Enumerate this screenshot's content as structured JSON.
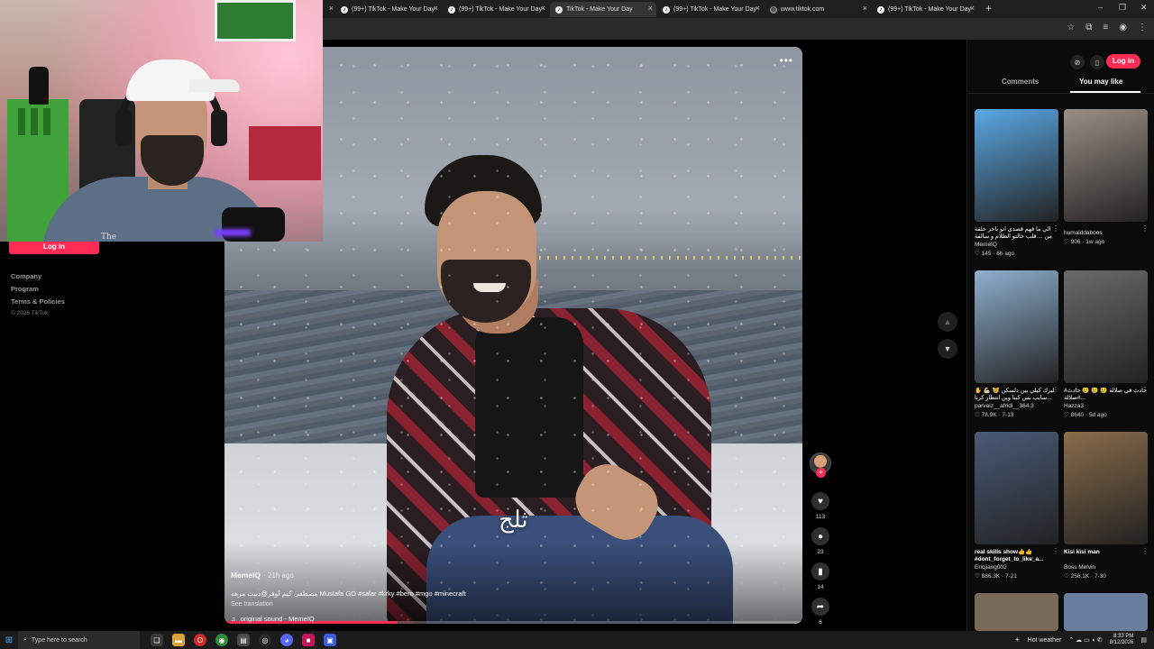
{
  "browser": {
    "tabs": [
      {
        "label": "(99+) TikTok - Make Your Day"
      },
      {
        "label": "(99+) TikTok - Make Your Day"
      },
      {
        "label": "TikTok - Make Your Day"
      },
      {
        "label": "(99+) TikTok - Make Your Day"
      },
      {
        "label": "www.tiktok.com"
      },
      {
        "label": "(99+) TikTok - Make Your Day"
      }
    ],
    "new_tab": "+",
    "window_controls": [
      "–",
      "❐",
      "✕"
    ]
  },
  "sidebar": {
    "login_label": "Log in",
    "links": [
      "Company",
      "Program",
      "Terms & Policies"
    ],
    "copyright": "© 2026 TikTok"
  },
  "webcam": {
    "shirt_text": "The"
  },
  "video": {
    "overlay_text": "ثلج",
    "author": "MemeIQ",
    "time": "· 21h ago",
    "caption": "مصطفى كيم لوفر@دبيت مرهه Mustafa GO #salar #krky #bero #mgo #minecraft",
    "see_translation": "See translation",
    "sound": "original sound - MemeIQ",
    "progress": 0.3,
    "more_icon": "more-dots-icon"
  },
  "actions": {
    "likes": "113",
    "comments": "23",
    "saves": "14",
    "shares": "6"
  },
  "panel": {
    "login_label": "Log in",
    "tab_comments": "Comments",
    "tab_you_may_like": "You may like",
    "cards": [
      {
        "title": "الي ما فهم قصدي انو باخر حلقة من ... قلب خالتو الظلام و سالفة الملك",
        "user": "MemeIQ",
        "likes": "145",
        "time": "6h ago",
        "bg": "#5aa9e6"
      },
      {
        "title": "",
        "user": "humaiddaboos",
        "likes": "906",
        "time": "1w ago",
        "bg": "#9a8f86"
      },
      {
        "title": "ليرك كيلي بين دلسكن 😿 💪🏻 ✋ ...سابب بس كبنا وين انتظار كرنا",
        "user": "parvaiz__afridi__364.3",
        "likes": "78.9K",
        "time": "7-13",
        "bg": "#8fb0d0"
      },
      {
        "title": "حادث في صلالة 😢 😢 😢 حادث# صلالة#...",
        "user": "Hazza3",
        "likes": "8640",
        "time": "5d ago",
        "bg": "#6a6a6a"
      },
      {
        "title": "real skills show👍👍 #dont_forget_to_like_a...",
        "user": "Ericjiang002",
        "likes": "886.3K",
        "time": "7-21",
        "bg": "#4a5a78"
      },
      {
        "title": "Kisi kisi man",
        "user": "Boss Melvin",
        "likes": "256.1K",
        "time": "7-30",
        "bg": "#8a6c4a"
      }
    ]
  },
  "taskbar": {
    "search_placeholder": "Type here to search",
    "weather": "Hot weather",
    "time": "8:33 PM",
    "date": "8/12/2026"
  }
}
